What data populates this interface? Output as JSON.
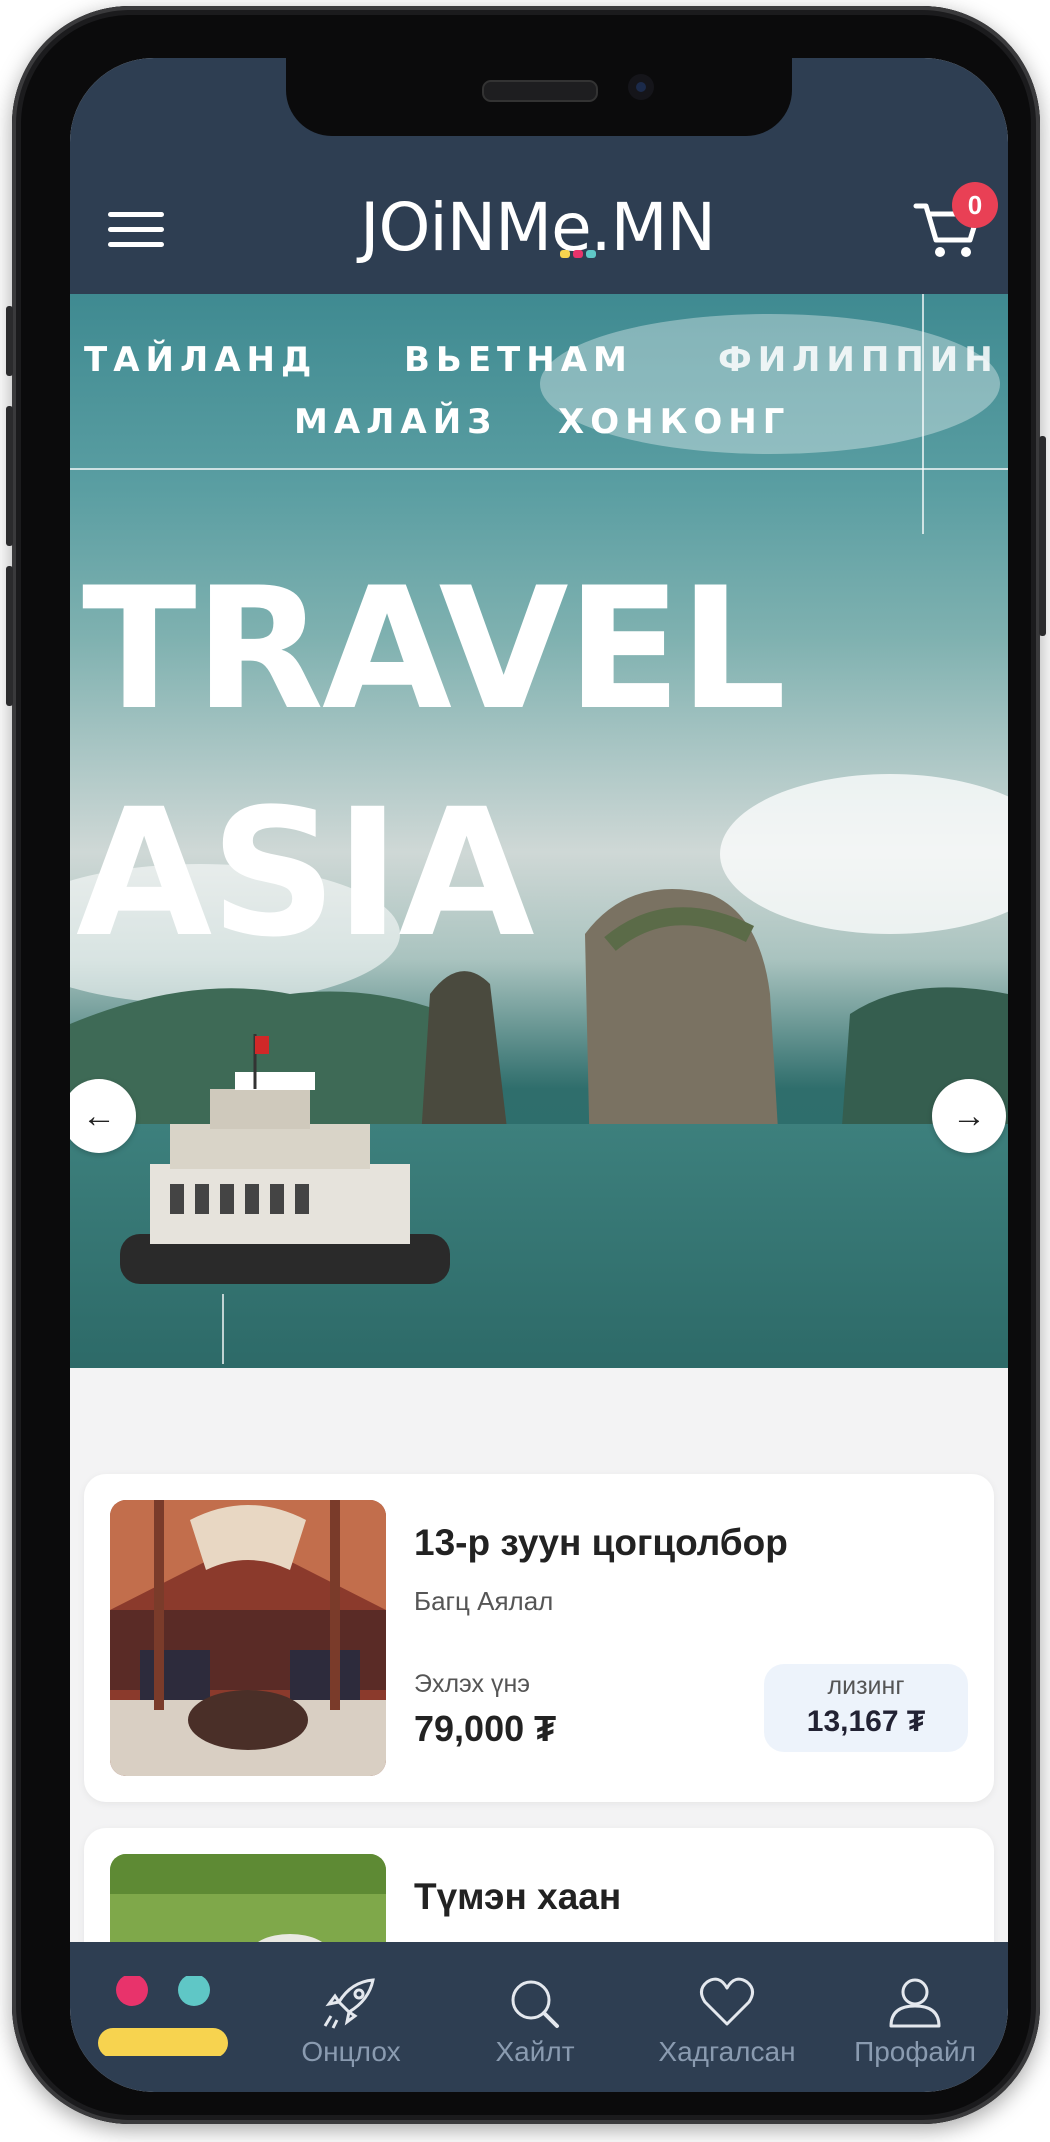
{
  "header": {
    "logo_text": "JOiNMe.MN",
    "cart_count": "0",
    "icons": [
      "hamburger-menu-icon",
      "cart-icon"
    ]
  },
  "hero": {
    "destinations_row1": [
      "ТАЙЛАНД",
      "ВЬЕТНАМ",
      "ФИЛИППИН"
    ],
    "destinations_row2": [
      "МАЛАЙЗ",
      "ХОНКОНГ"
    ],
    "headline_1": "TRAVEL",
    "headline_2": "ASIA",
    "prev_icon": "arrow-left-icon",
    "next_icon": "arrow-right-icon"
  },
  "cards": [
    {
      "title": "13-р зуун цогцолбор",
      "subtitle": "Багц Аялал",
      "price_label": "Эхлэх үнэ",
      "price": "79,000 ₮",
      "lease_label": "лизинг",
      "lease_value": "13,167 ₮"
    },
    {
      "title": "Түмэн хаан"
    }
  ],
  "bottom_nav": [
    {
      "label": "",
      "icon": "home-dots-icon"
    },
    {
      "label": "Онцлох",
      "icon": "rocket-icon"
    },
    {
      "label": "Хайлт",
      "icon": "search-icon"
    },
    {
      "label": "Хадгалсан",
      "icon": "heart-icon"
    },
    {
      "label": "Профайл",
      "icon": "user-icon"
    }
  ],
  "colors": {
    "header_bg": "#2e3e52",
    "badge": "#e94055",
    "lease_bg": "#edf3fb",
    "dot_pink": "#e8336b",
    "dot_teal": "#5fc7c6",
    "pill_yellow": "#f7d34f",
    "nav_inactive": "#8a9bb0"
  }
}
